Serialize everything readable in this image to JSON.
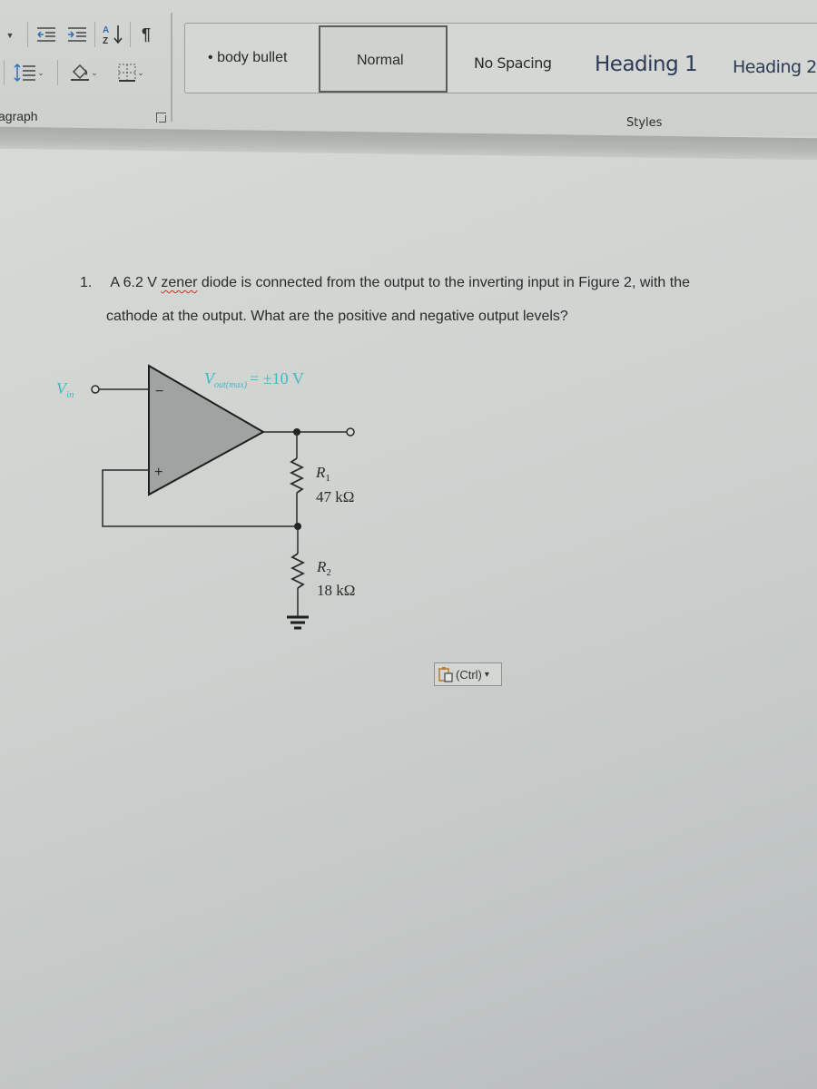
{
  "ribbon": {
    "paragraph_group": {
      "label": "agraph",
      "buttons": [
        {
          "name": "decrease-indent",
          "glyph": "⇤"
        },
        {
          "name": "increase-indent",
          "glyph": "⇥"
        },
        {
          "name": "sort",
          "glyph": "A↓"
        },
        {
          "name": "show-formatting-marks",
          "glyph": "¶"
        },
        {
          "name": "line-spacing",
          "glyph": "↕"
        },
        {
          "name": "shading",
          "glyph": "◇"
        },
        {
          "name": "borders",
          "glyph": "⊞"
        }
      ]
    },
    "styles_group": {
      "label": "Styles",
      "items": [
        {
          "label": "body bullet",
          "bullet": "•"
        },
        {
          "label": "Normal",
          "selected": true
        },
        {
          "label": "No Spacing"
        },
        {
          "label": "Heading 1"
        },
        {
          "label": "Heading 2"
        }
      ]
    }
  },
  "document": {
    "question": {
      "number": "1.",
      "line1_pre": "A 6.2 V ",
      "line1_flagged_word": "zener",
      "line1_post": " diode is connected from the output to the inverting input in Figure 2, with the",
      "line2": "cathode at the output. What are the positive and negative output levels?"
    },
    "figure": {
      "vin_label": "V",
      "vin_sub": "in",
      "vout_label": "V",
      "vout_sub": "out(max)",
      "vout_value": "= ±10 V",
      "minus_sign": "−",
      "plus_sign": "+",
      "r1_name": "R",
      "r1_sub": "1",
      "r1_value": "47 kΩ",
      "r2_name": "R",
      "r2_sub": "2",
      "r2_value": "18 kΩ",
      "label_color": "#3fb8c4"
    },
    "paste_options": {
      "label": "(Ctrl)",
      "chevron": "▾"
    }
  }
}
